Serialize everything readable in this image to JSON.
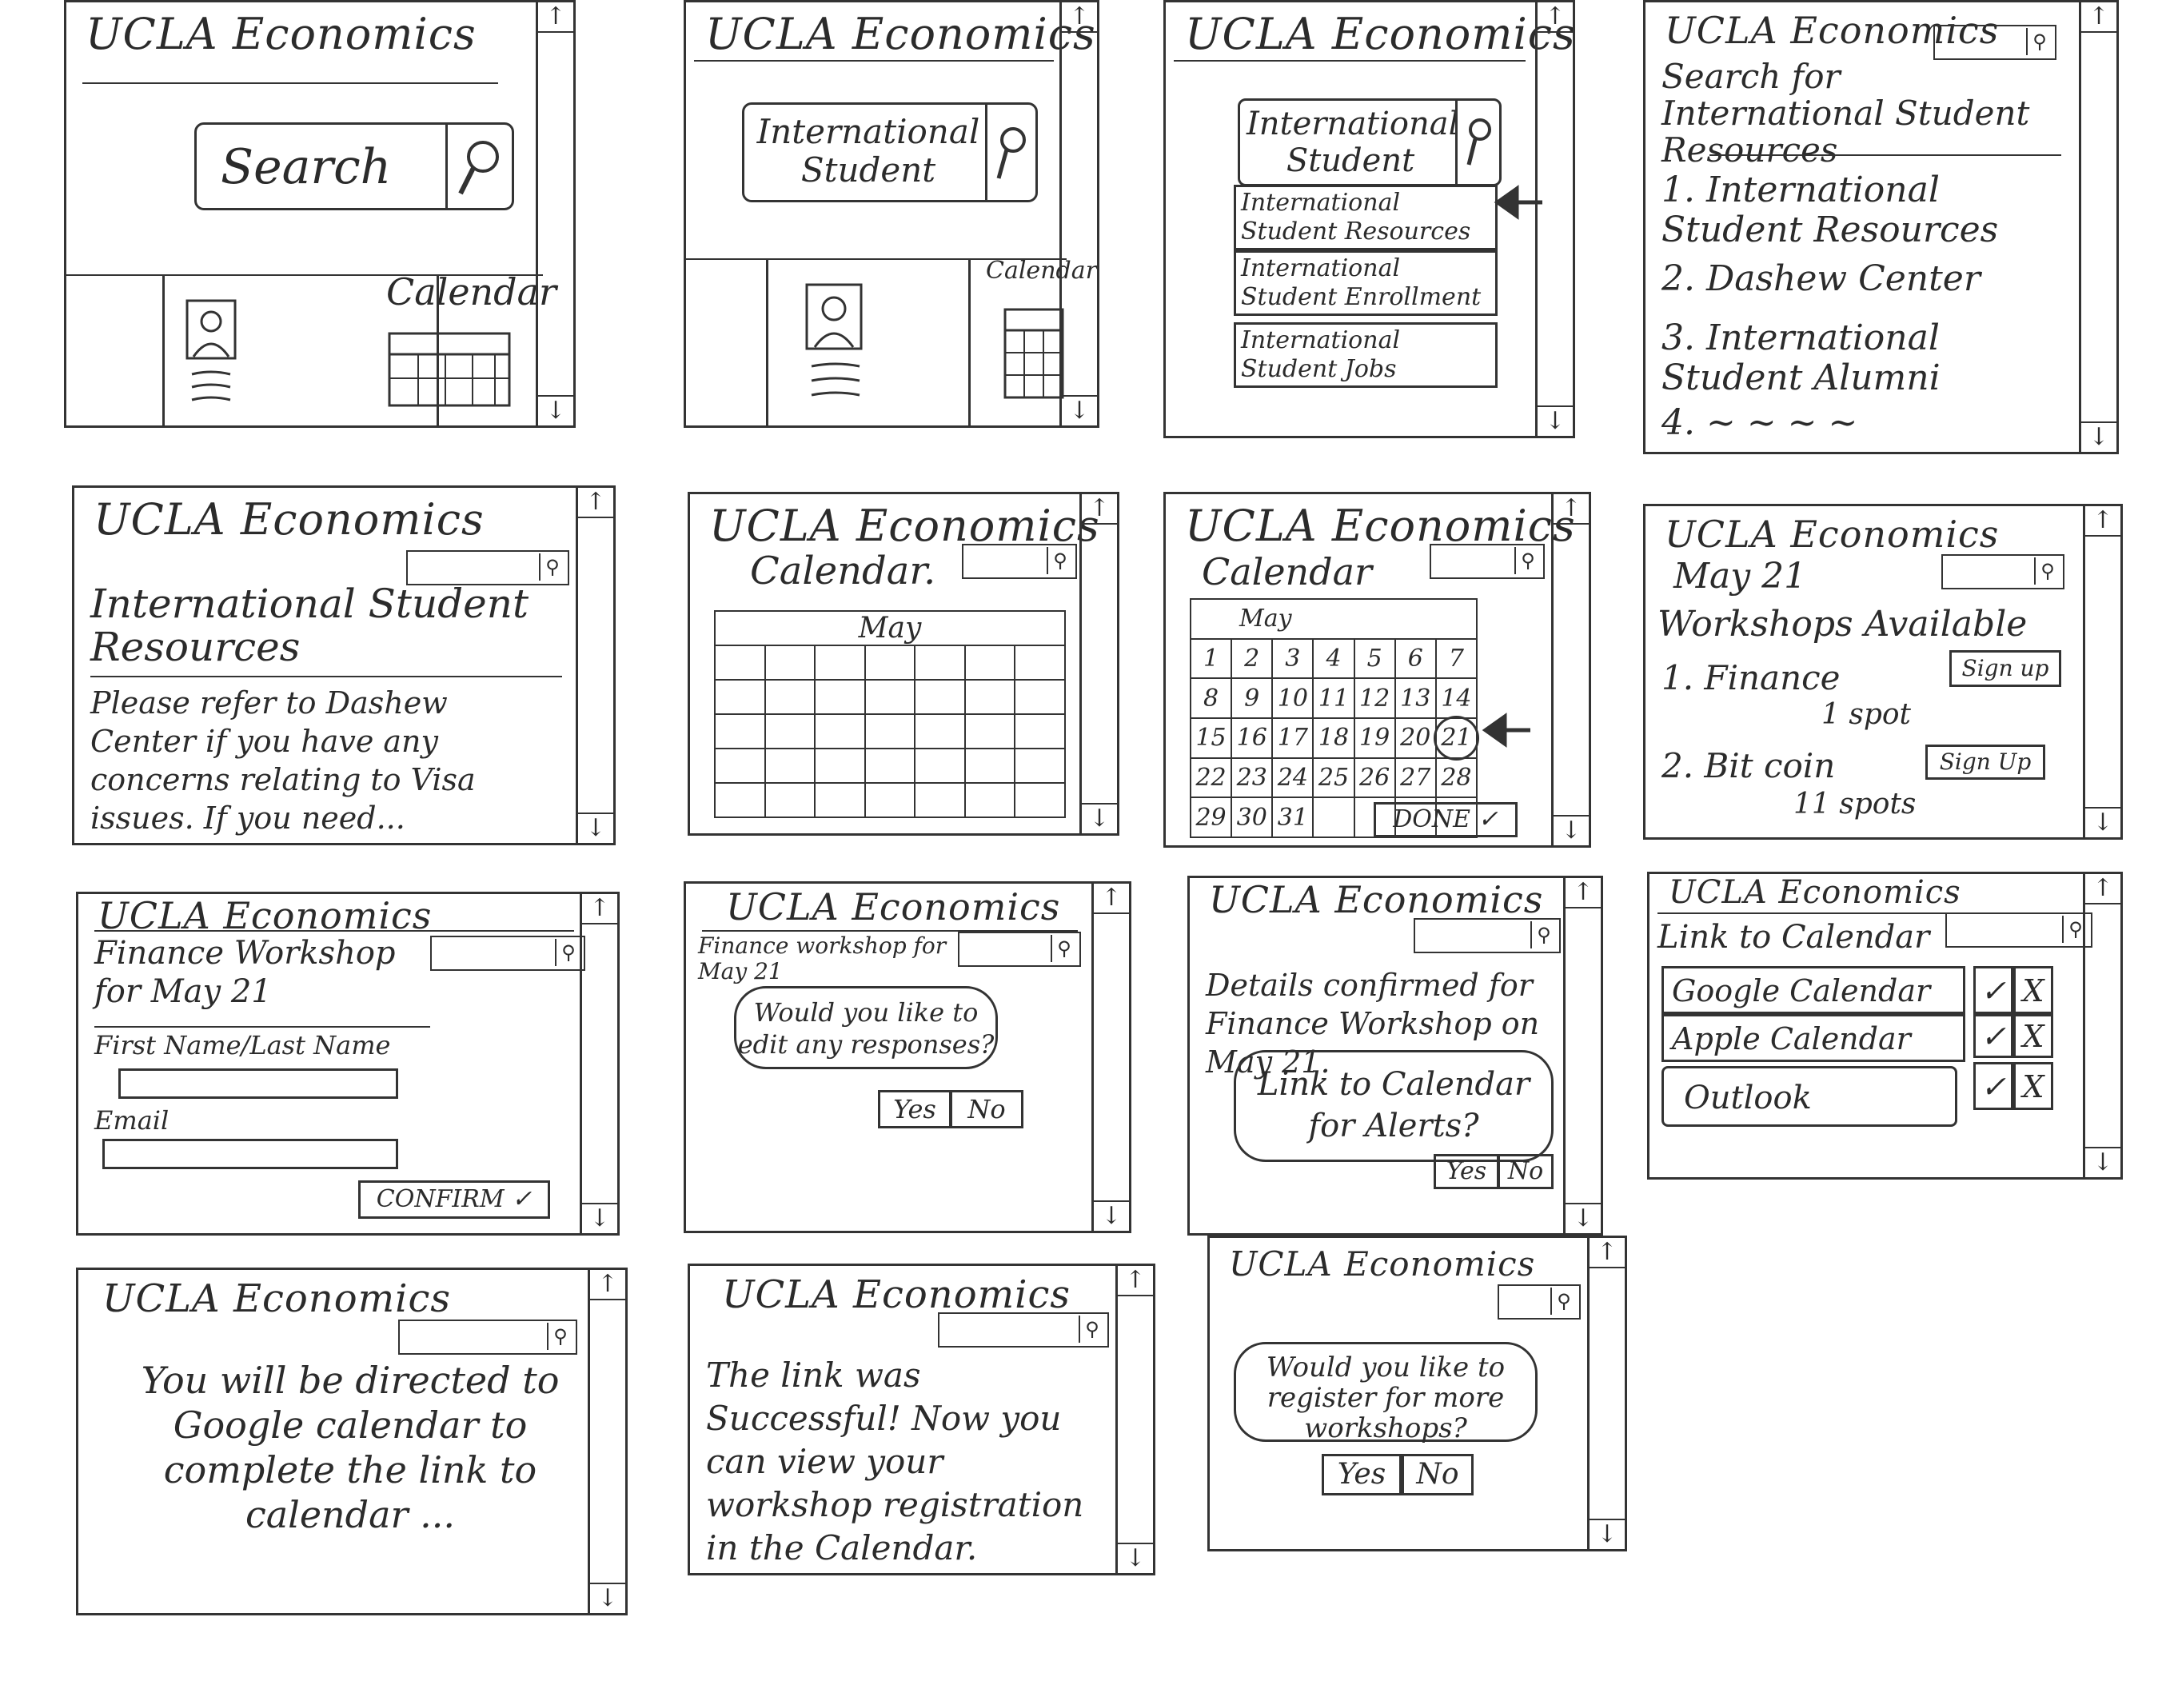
{
  "app_title": "UCLA Economics",
  "scroll_up": "↑",
  "scroll_down": "↓",
  "frames": {
    "f1": {
      "search_label": "Search",
      "calendar_label": "Calendar"
    },
    "f2": {
      "search_value": "International Student",
      "calendar_label": "Calendar"
    },
    "f3": {
      "search_value": "International Student",
      "suggestions": [
        "International Student Resources",
        "International Student Enrollment",
        "International Student Jobs"
      ]
    },
    "f4": {
      "heading": "Search for International Student Resources",
      "results": [
        "1. International Student Resources",
        "2. Dashew Center",
        "3. International Student Alumni",
        "4. ~ ~ ~ ~"
      ]
    },
    "f5": {
      "heading": "International Student Resources",
      "body": "Please refer to Dashew Center if you have any concerns relating to Visa issues. If you need..."
    },
    "f6": {
      "heading": "Calendar.",
      "month": "May"
    },
    "f7": {
      "heading": "Calendar",
      "month": "May",
      "days": [
        "1",
        "2",
        "3",
        "4",
        "5",
        "6",
        "7",
        "8",
        "9",
        "10",
        "11",
        "12",
        "13",
        "14",
        "15",
        "16",
        "17",
        "18",
        "19",
        "20",
        "21",
        "22",
        "23",
        "24",
        "25",
        "26",
        "27",
        "28",
        "29",
        "30",
        "31"
      ],
      "done_label": "DONE ✓"
    },
    "f8": {
      "date": "May 21",
      "heading": "Workshops Available",
      "workshops": [
        {
          "name": "1. Finance",
          "spots": "1 spot",
          "button": "Sign up"
        },
        {
          "name": "2. Bit coin",
          "spots": "11 spots",
          "button": "Sign Up"
        }
      ]
    },
    "f9": {
      "heading": "Finance Workshop for May 21",
      "name_label": "First Name/Last Name",
      "email_label": "Email",
      "confirm_label": "CONFIRM ✓"
    },
    "f10": {
      "heading": "Finance workshop for May 21",
      "question": "Would you like to edit any responses?",
      "yes": "Yes",
      "no": "No"
    },
    "f11": {
      "body": "Details confirmed for Finance Workshop on May 21.",
      "question": "Link to Calendar for Alerts?",
      "yes": "Yes",
      "no": "No"
    },
    "f12": {
      "heading": "Link to Calendar",
      "options": [
        "Google Calendar",
        "Apple Calendar",
        "Outlook"
      ],
      "check": "✓",
      "cross": "X"
    },
    "f13": {
      "body": "You will be directed to Google calendar to complete the link to calendar ..."
    },
    "f14": {
      "body": "The link was Successful! Now you can view your workshop registration in the Calendar."
    },
    "f15": {
      "question": "Would you like to register for more workshops?",
      "yes": "Yes",
      "no": "No"
    }
  }
}
